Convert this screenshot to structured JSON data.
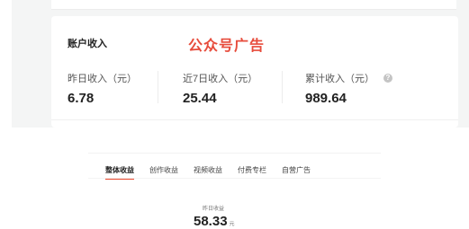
{
  "earnings_card": {
    "title": "账户收入",
    "watermark": "公众号广告",
    "stats": [
      {
        "label": "昨日收入（元）",
        "value": "6.78"
      },
      {
        "label": "近7日收入（元）",
        "value": "25.44"
      },
      {
        "label": "累计收入（元）",
        "value": "989.64",
        "icon": "help-icon"
      }
    ],
    "help_icon_glyph": "?"
  },
  "income_panel": {
    "tabs": [
      {
        "label": "整体收益",
        "active": true
      },
      {
        "label": "创作收益",
        "active": false
      },
      {
        "label": "视频收益",
        "active": false
      },
      {
        "label": "付费专栏",
        "active": false
      },
      {
        "label": "自营广告",
        "active": false
      }
    ],
    "yesterday_label": "昨日收益",
    "yesterday_value": "58.33",
    "yesterday_unit": "元"
  },
  "colors": {
    "accent": "#e8452c",
    "watermark": "#e74c3c",
    "page_background": "#f4f5f5"
  }
}
